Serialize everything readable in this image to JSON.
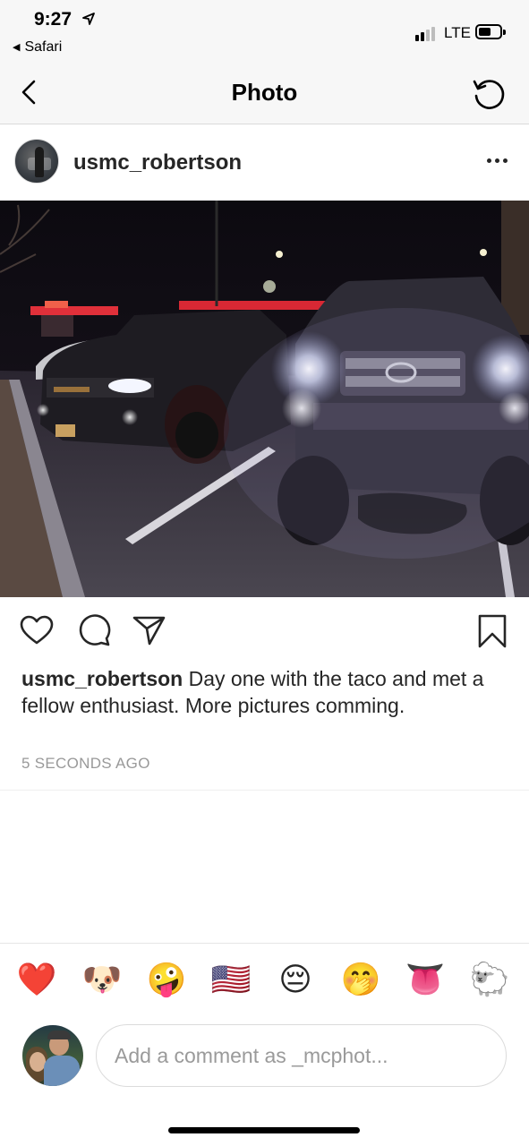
{
  "status_bar": {
    "time": "9:27",
    "back_app": "Safari",
    "network": "LTE",
    "icons": [
      "location-arrow-icon",
      "signal-bars-icon",
      "battery-icon"
    ]
  },
  "nav": {
    "title": "Photo",
    "back_icon": "chevron-left-icon",
    "refresh_icon": "refresh-icon"
  },
  "post": {
    "username": "usmc_robertson",
    "more_icon": "more-dots-icon",
    "actions": [
      "heart-icon",
      "comment-icon",
      "share-icon",
      "bookmark-icon"
    ],
    "caption_user": "usmc_robertson",
    "caption_text": " Day one with the taco and met a fellow enthusiast. More pictures comming.",
    "timestamp": "5 SECONDS AGO"
  },
  "emoji_bar": [
    "❤️",
    "🐶",
    "🤪",
    "🇺🇸",
    "😔",
    "🤭",
    "👅",
    "🐑"
  ],
  "comment": {
    "placeholder": "Add a comment as _mcphot..."
  },
  "colors": {
    "text": "#262626",
    "muted": "#999999",
    "bar_bg": "#f7f7f7"
  }
}
